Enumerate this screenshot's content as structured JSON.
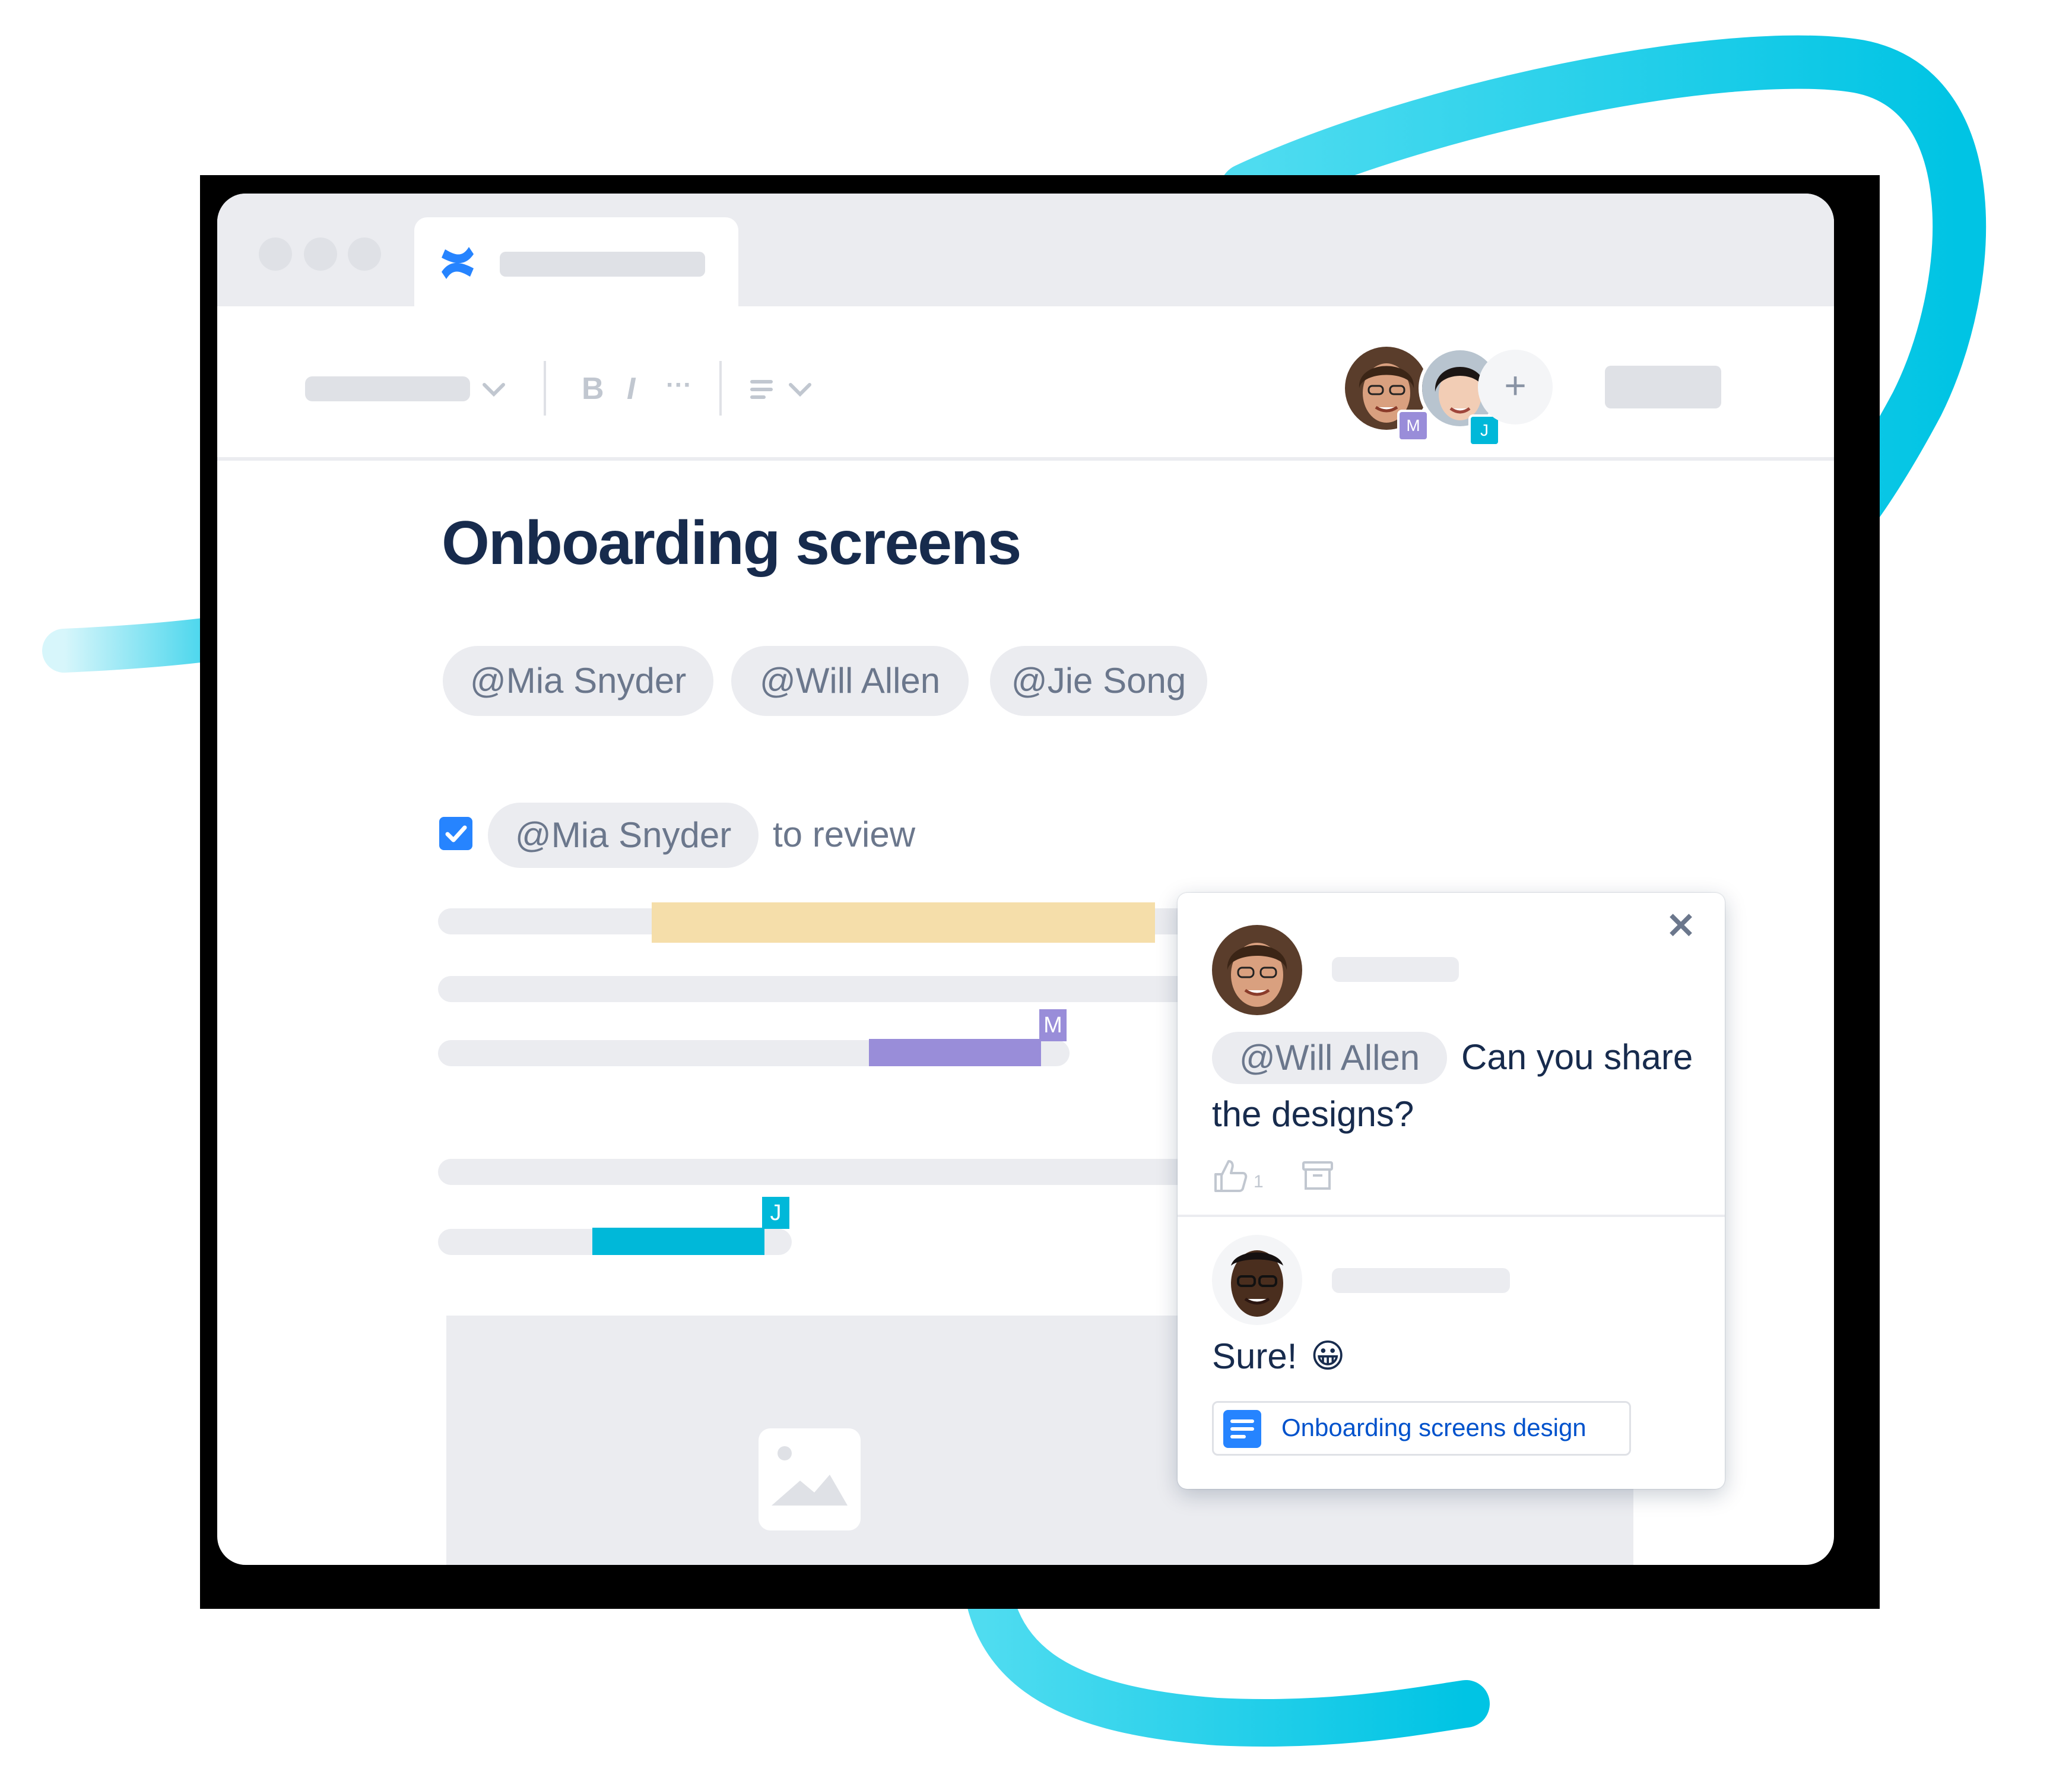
{
  "colors": {
    "ribbon": "#00c7e6",
    "title": "#172b4d",
    "accent_blue": "#2684ff",
    "mention_m": "#998dd9",
    "mention_j": "#00b8d9",
    "highlight_yellow": "#f5deaa"
  },
  "app": {
    "logo_icon": "confluence-logo-icon"
  },
  "toolbar": {
    "bold_label": "B",
    "italic_label": "I",
    "more_label": "···",
    "collaborators": [
      {
        "initial": "M",
        "color": "#998dd9"
      },
      {
        "initial": "J",
        "color": "#00b8d9"
      }
    ],
    "add_label": "+"
  },
  "page": {
    "title": "Onboarding screens",
    "mentions": [
      "@Mia Snyder",
      "@Will Allen",
      "@Jie Song"
    ],
    "task": {
      "checked": true,
      "mention": "@Mia Snyder",
      "text": "to review"
    },
    "cursor_markers": [
      "M",
      "J"
    ]
  },
  "comments": {
    "close_label": "✕",
    "first": {
      "mention": "@Will Allen",
      "text_line1": "Can you share",
      "text_line2": "the designs?",
      "like_count": "1"
    },
    "second": {
      "text": "Sure!",
      "emoji": "😀",
      "link_label": "Onboarding screens design"
    }
  }
}
